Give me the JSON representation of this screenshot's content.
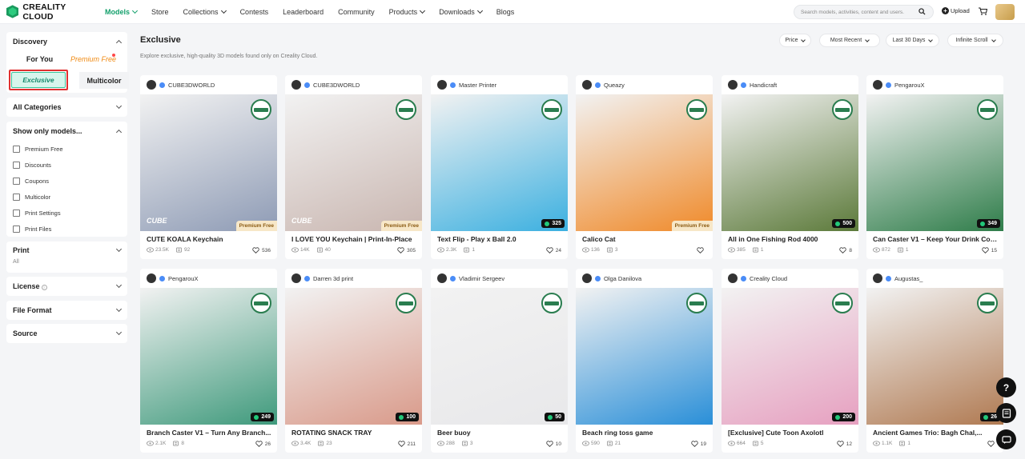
{
  "header": {
    "logo_text": "CREALITY CLOUD",
    "nav": [
      {
        "label": "Models",
        "active": true,
        "dropdown": true
      },
      {
        "label": "Store",
        "active": false,
        "dropdown": false
      },
      {
        "label": "Collections",
        "active": false,
        "dropdown": true
      },
      {
        "label": "Contests",
        "active": false,
        "dropdown": false
      },
      {
        "label": "Leaderboard",
        "active": false,
        "dropdown": false
      },
      {
        "label": "Community",
        "active": false,
        "dropdown": false
      },
      {
        "label": "Products",
        "active": false,
        "dropdown": true
      },
      {
        "label": "Downloads",
        "active": false,
        "dropdown": true
      },
      {
        "label": "Blogs",
        "active": false,
        "dropdown": false
      }
    ],
    "search_placeholder": "Search models, activities, content and users.",
    "upload_label": "Upload"
  },
  "sidebar": {
    "discovery_title": "Discovery",
    "tabs": {
      "for_you": "For You",
      "premium_free": "Premium Free",
      "exclusive": "Exclusive",
      "multicolor": "Multicolor"
    },
    "all_categories": "All Categories",
    "show_only_title": "Show only models...",
    "show_only_items": [
      "Premium Free",
      "Discounts",
      "Coupons",
      "Multicolor",
      "Print Settings",
      "Print Files"
    ],
    "print_title": "Print",
    "print_value": "All",
    "license_title": "License",
    "file_format_title": "File Format",
    "source_title": "Source"
  },
  "main": {
    "title": "Exclusive",
    "subtitle": "Explore exclusive, high-quality 3D models found only on Creality Cloud.",
    "filters": {
      "price": "Price",
      "sort": "Most Recent",
      "period": "Last 30 Days",
      "scroll": "Infinite Scroll"
    },
    "cards": [
      {
        "author": "CUBE3DWORLD",
        "title": "CUTE KOALA Keychain",
        "views": "23.5K",
        "downloads": "92",
        "likes": "536",
        "tag": "Premium Free",
        "count": "",
        "brand": "CUBE",
        "accent": "#8e9bb5"
      },
      {
        "author": "CUBE3DWORLD",
        "title": "I LOVE YOU Keychain | Print-In-Place",
        "views": "14K",
        "downloads": "40",
        "likes": "305",
        "tag": "Premium Free",
        "count": "",
        "brand": "CUBE",
        "accent": "#c9b6b0"
      },
      {
        "author": "Master Printer",
        "title": "Text Flip - Play x Ball 2.0",
        "views": "2.3K",
        "downloads": "1",
        "likes": "24",
        "tag": "",
        "count": "325",
        "brand": "",
        "accent": "#3cb0e0"
      },
      {
        "author": "Queazy",
        "title": "Calico Cat",
        "views": "136",
        "downloads": "3",
        "likes": "",
        "tag": "Premium Free",
        "count": "",
        "brand": "",
        "accent": "#f08a2a"
      },
      {
        "author": "Handicraft",
        "title": "All in One Fishing Rod 4000",
        "views": "385",
        "downloads": "1",
        "likes": "8",
        "tag": "",
        "count": "500",
        "brand": "",
        "accent": "#5c7a3a"
      },
      {
        "author": "PengarouX",
        "title": "Can Caster V1 – Keep Your Drink Col...",
        "views": "872",
        "downloads": "1",
        "likes": "15",
        "tag": "",
        "count": "349",
        "brand": "",
        "accent": "#2f7d4a"
      },
      {
        "author": "PengarouX",
        "title": "Branch Caster V1 – Turn Any Branch...",
        "views": "2.1K",
        "downloads": "8",
        "likes": "26",
        "tag": "",
        "count": "249",
        "brand": "",
        "accent": "#3f9a7c"
      },
      {
        "author": "Darren 3d print",
        "title": "ROTATING SNACK TRAY",
        "views": "3.4K",
        "downloads": "23",
        "likes": "211",
        "tag": "",
        "count": "100",
        "brand": "",
        "accent": "#d99a8a"
      },
      {
        "author": "Vladimir Sergeev",
        "title": "Beer buoy",
        "views": "288",
        "downloads": "3",
        "likes": "10",
        "tag": "",
        "count": "50",
        "brand": "",
        "accent": "#e8e8ea"
      },
      {
        "author": "Olga Danilova",
        "title": "Beach ring toss game",
        "views": "590",
        "downloads": "21",
        "likes": "19",
        "tag": "",
        "count": "",
        "brand": "",
        "accent": "#2a8fd8"
      },
      {
        "author": "Creality Cloud",
        "title": "[Exclusive] Cute Toon Axolotl",
        "views": "664",
        "downloads": "5",
        "likes": "12",
        "tag": "",
        "count": "200",
        "brand": "",
        "accent": "#e6a0c0"
      },
      {
        "author": "Augustas_",
        "title": "Ancient Games Trio: Bagh Chal,...",
        "views": "1.1K",
        "downloads": "1",
        "likes": "",
        "tag": "",
        "count": "26",
        "brand": "",
        "accent": "#b07a52"
      }
    ]
  },
  "colors": {
    "brand_green": "#14a06c",
    "highlight_red": "#e03030"
  }
}
